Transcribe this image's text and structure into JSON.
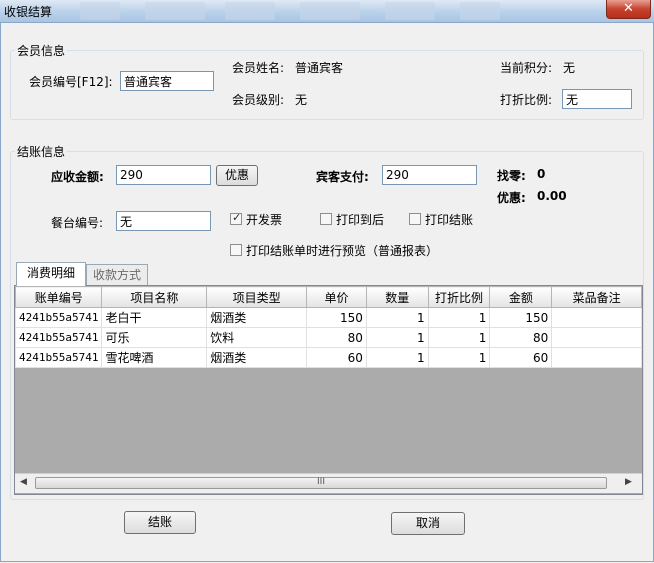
{
  "window": {
    "title": "收银结算",
    "close": "✕"
  },
  "member": {
    "legend": "会员信息",
    "id_label": "会员编号[F12]:",
    "id_value": "普通宾客",
    "name_label": "会员姓名:",
    "name_value": "普通宾客",
    "points_label": "当前积分:",
    "points_value": "无",
    "level_label": "会员级别:",
    "level_value": "无",
    "discount_label": "打折比例:",
    "discount_value": "无"
  },
  "checkout": {
    "legend": "结账信息",
    "receivable_label": "应收金额:",
    "receivable_value": "290",
    "discount_button": "优惠",
    "guest_pay_label": "宾客支付:",
    "guest_pay_value": "290",
    "change_label": "找零:",
    "change_value": "0",
    "discount_amount_label": "优惠:",
    "discount_amount_value": "0.00",
    "table_no_label": "餐台编号:",
    "table_no_value": "无",
    "invoice_label": "开发票",
    "invoice_checked": true,
    "print_to_back_label": "打印到后",
    "print_checkout_label": "打印结账",
    "preview_label": "打印结账单时进行预览（普通报表）"
  },
  "tabs": [
    {
      "label": "消费明细",
      "active": true
    },
    {
      "label": "收款方式",
      "active": false
    }
  ],
  "grid": {
    "columns": [
      "账单编号",
      "项目名称",
      "项目类型",
      "单价",
      "数量",
      "打折比例",
      "金额",
      "菜品备注"
    ],
    "rows": [
      [
        "4241b55a5741",
        "老白干",
        "烟酒类",
        "150",
        "1",
        "1",
        "150",
        ""
      ],
      [
        "4241b55a5741",
        "可乐",
        "饮料",
        "80",
        "1",
        "1",
        "80",
        ""
      ],
      [
        "4241b55a5741",
        "雪花啤酒",
        "烟酒类",
        "60",
        "1",
        "1",
        "60",
        ""
      ]
    ],
    "scroll_left": "◀",
    "scroll_right": "▶",
    "scroll_grip": "III"
  },
  "buttons": {
    "checkout": "结账",
    "cancel": "取消"
  }
}
